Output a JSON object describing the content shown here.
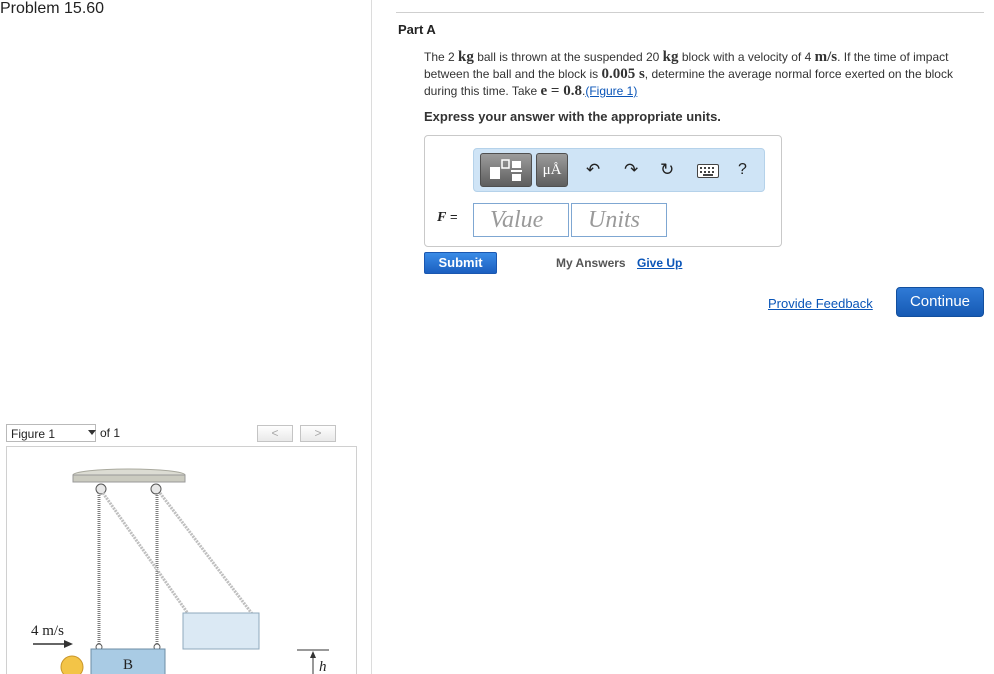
{
  "problem": {
    "title": "Problem 15.60"
  },
  "figure": {
    "selected": "Figure 1",
    "of_label": "of 1",
    "prev_glyph": "<",
    "next_glyph": ">",
    "labels": {
      "velocity": "4 m/s",
      "block": "B",
      "height": "h"
    },
    "colors": {
      "block": "#a9cbe4",
      "ball": "#f3c447",
      "ceiling": "#dcdcd3",
      "rope": "#9b9b9b"
    }
  },
  "part": {
    "title": "Part A",
    "question": {
      "t1": "The 2 ",
      "m1": "kg",
      "t2": " ball is thrown at the suspended 20 ",
      "m2": "kg",
      "t3": " block with a velocity of 4 ",
      "m3": "m/s",
      "t4": ". If the time of impact between the ball and the block is ",
      "m4": "0.005 s",
      "t5": ", determine the average normal force exerted on the block during this time. Take ",
      "m5": "e = 0.8",
      "t6": ".",
      "link": "(Figure 1)"
    },
    "instruction": "Express your answer with the appropriate units."
  },
  "answer": {
    "variable": "F",
    "equals": "=",
    "value_placeholder": "Value",
    "units_placeholder": "Units",
    "toolbar": {
      "templates_icon": "templates-icon",
      "units_label": "μÅ",
      "undo_icon": "undo-icon",
      "redo_icon": "redo-icon",
      "reset_icon": "reset-icon",
      "keyboard_icon": "keyboard-icon",
      "help_label": "?"
    }
  },
  "actions": {
    "submit": "Submit",
    "my_answers": "My Answers",
    "give_up": "Give Up",
    "provide_feedback": "Provide Feedback",
    "continue": "Continue"
  },
  "colors": {
    "accent": "#1f6fd1",
    "link": "#0a55b8",
    "toolbar_bg": "#cfe4f6"
  }
}
